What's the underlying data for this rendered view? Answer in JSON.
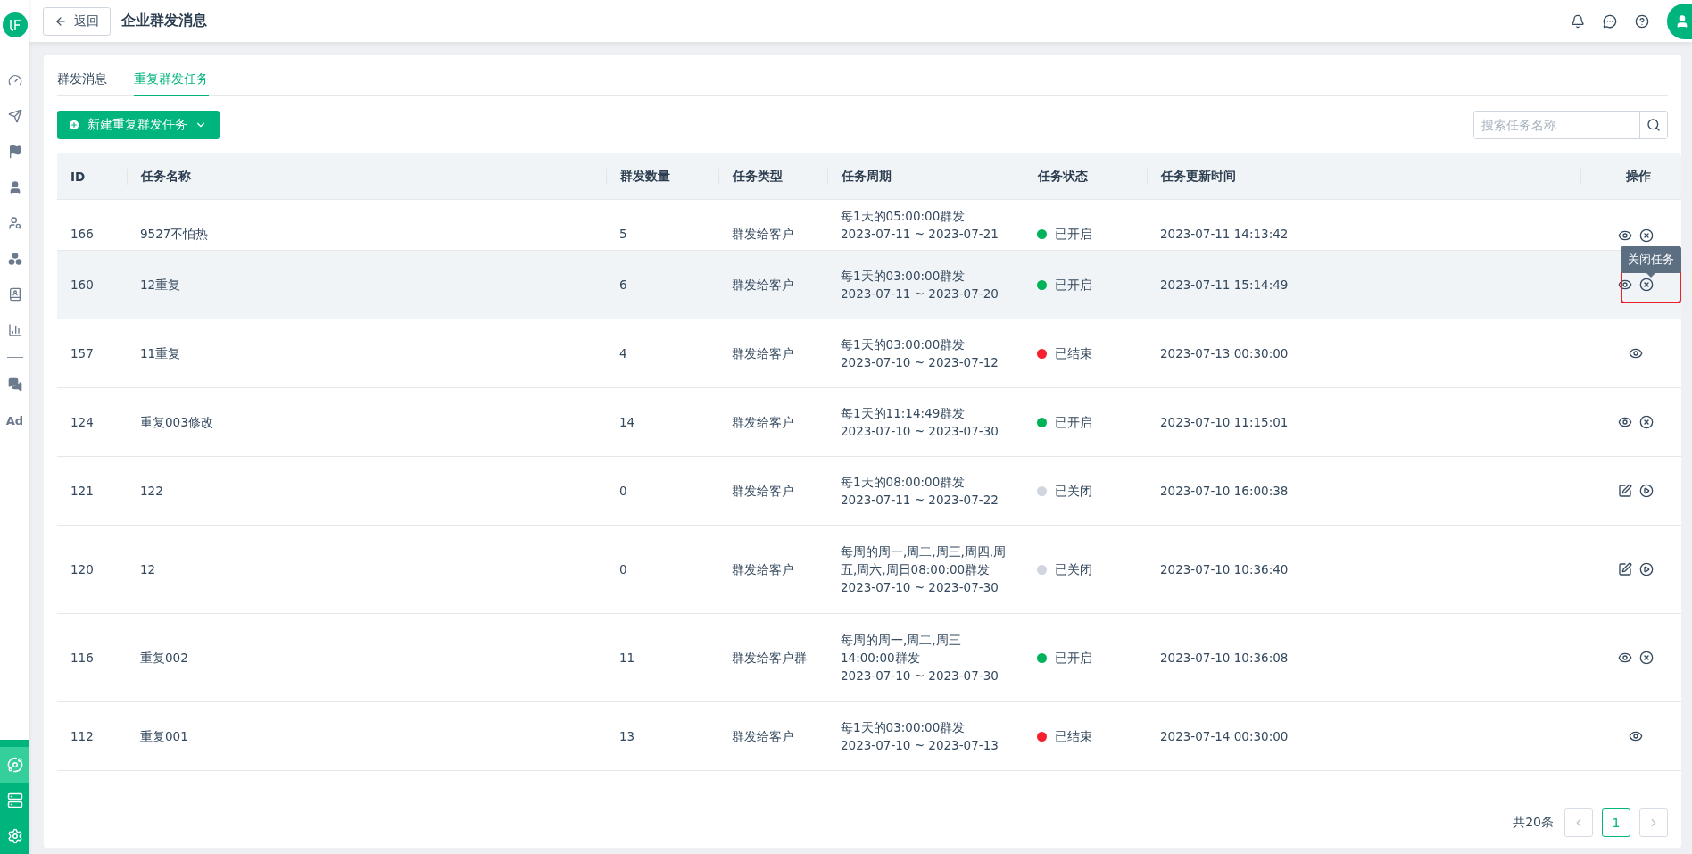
{
  "sidebar": {
    "items": [
      {
        "kind": "dashboard"
      },
      {
        "kind": "send"
      },
      {
        "kind": "flag"
      },
      {
        "kind": "user"
      },
      {
        "kind": "user-search"
      },
      {
        "kind": "cluster"
      },
      {
        "kind": "badge"
      },
      {
        "kind": "chart"
      },
      {
        "kind": "divider"
      },
      {
        "kind": "chat"
      },
      {
        "kind": "text",
        "label": "Ad"
      }
    ],
    "bottom_items": [
      {
        "kind": "orbit",
        "selected": true
      },
      {
        "kind": "server",
        "selected": false
      },
      {
        "kind": "settings",
        "selected": false
      }
    ]
  },
  "header": {
    "back_button": "返回",
    "title": "企业群发消息"
  },
  "tabs": [
    {
      "label": "群发消息",
      "selected": false
    },
    {
      "label": "重复群发任务",
      "selected": true
    }
  ],
  "new_button": "新建重复群发任务",
  "search": {
    "placeholder": "搜索任务名称"
  },
  "table": {
    "columns": [
      "ID",
      "任务名称",
      "群发数量",
      "任务类型",
      "任务周期",
      "任务状态",
      "任务更新时间",
      "操作"
    ],
    "rows": [
      {
        "id": "166",
        "name": "9527不怕热",
        "count": "5",
        "type": "群发给客户",
        "cycle": [
          "每1天的05:00:00群发",
          "2023-07-11 ~ 2023-07-21"
        ],
        "status": "已开启",
        "color": "#00b259",
        "updated": "2023-07-11 14:13:42",
        "actions": [
          {
            "kind": "view"
          },
          {
            "kind": "close"
          }
        ],
        "highlighted": false,
        "clipped": true
      },
      {
        "id": "160",
        "name": "12重复",
        "count": "6",
        "type": "群发给客户",
        "cycle": [
          "每1天的03:00:00群发",
          "2023-07-11 ~ 2023-07-20"
        ],
        "status": "已开启",
        "color": "#00b259",
        "updated": "2023-07-11 15:14:49",
        "actions": [
          {
            "kind": "view"
          },
          {
            "kind": "close"
          }
        ],
        "highlighted": true,
        "tooltip": "关闭任务"
      },
      {
        "id": "157",
        "name": "11重复",
        "count": "4",
        "type": "群发给客户",
        "cycle": [
          "每1天的03:00:00群发",
          "2023-07-10 ~ 2023-07-12"
        ],
        "status": "已结束",
        "color": "#f5222d",
        "updated": "2023-07-13 00:30:00",
        "actions": [
          {
            "kind": "view"
          }
        ],
        "highlighted": false
      },
      {
        "id": "124",
        "name": "重复003修改",
        "count": "14",
        "type": "群发给客户",
        "cycle": [
          "每1天的11:14:49群发",
          "2023-07-10 ~ 2023-07-30"
        ],
        "status": "已开启",
        "color": "#00b259",
        "updated": "2023-07-10 11:15:01",
        "actions": [
          {
            "kind": "view"
          },
          {
            "kind": "close"
          }
        ],
        "highlighted": false
      },
      {
        "id": "121",
        "name": "122",
        "count": "0",
        "type": "群发给客户",
        "cycle": [
          "每1天的08:00:00群发",
          "2023-07-11 ~ 2023-07-22"
        ],
        "status": "已关闭",
        "color": "#cfd6de",
        "updated": "2023-07-10 16:00:38",
        "actions": [
          {
            "kind": "edit"
          },
          {
            "kind": "start"
          }
        ],
        "highlighted": false
      },
      {
        "id": "120",
        "name": "12",
        "count": "0",
        "type": "群发给客户",
        "cycle": [
          "每周的周一,周二,周三,周四,周",
          "五,周六,周日08:00:00群发",
          "2023-07-10 ~ 2023-07-30"
        ],
        "status": "已关闭",
        "color": "#cfd6de",
        "updated": "2023-07-10 10:36:40",
        "actions": [
          {
            "kind": "edit"
          },
          {
            "kind": "start"
          }
        ],
        "highlighted": false
      },
      {
        "id": "116",
        "name": "重复002",
        "count": "11",
        "type": "群发给客户群",
        "cycle": [
          "每周的周一,周二,周三",
          "14:00:00群发",
          "2023-07-10 ~ 2023-07-30"
        ],
        "status": "已开启",
        "color": "#00b259",
        "updated": "2023-07-10 10:36:08",
        "actions": [
          {
            "kind": "view"
          },
          {
            "kind": "close"
          }
        ],
        "highlighted": false
      },
      {
        "id": "112",
        "name": "重复001",
        "count": "13",
        "type": "群发给客户",
        "cycle": [
          "每1天的03:00:00群发",
          "2023-07-10 ~ 2023-07-13"
        ],
        "status": "已结束",
        "color": "#f5222d",
        "updated": "2023-07-14 00:30:00",
        "actions": [
          {
            "kind": "view"
          }
        ],
        "highlighted": false
      }
    ]
  },
  "pagination": {
    "total": "共20条",
    "pages": [
      {
        "label": "1",
        "selected": true
      }
    ]
  }
}
